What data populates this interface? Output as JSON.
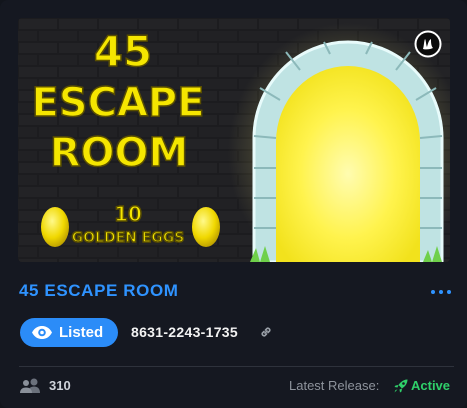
{
  "island": {
    "art": {
      "title_line1": "45",
      "title_line2": "ESCAPE",
      "title_line3": "ROOM",
      "eggs_count": "10",
      "eggs_label": "GOLDEN EGGS",
      "engine_logo": "unreal-engine-logo",
      "scene": "glowing stone archway doorway on dark brick wall"
    },
    "title": "45 ESCAPE ROOM",
    "menu_icon": "more-dots-icon",
    "status_badge": {
      "label": "Listed",
      "icon": "eye-icon"
    },
    "island_code": "8631-2243-1735",
    "link_icon": "link-icon",
    "players": {
      "icon": "players-icon",
      "count": "310"
    },
    "release": {
      "label": "Latest Release:",
      "icon": "rocket-icon",
      "status": "Active"
    }
  },
  "colors": {
    "background": "#151821",
    "accent_blue": "#2f93ff",
    "badge_blue": "#2b8cf8",
    "active_green": "#2fd06a",
    "title_yellow": "#f5e600"
  }
}
